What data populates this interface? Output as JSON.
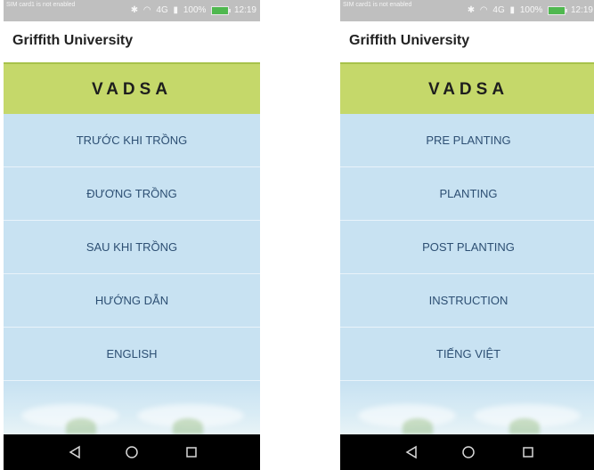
{
  "screens": [
    {
      "status": {
        "sim_text": "SIM card1 is not enabled",
        "battery": "100%",
        "time": "12:19",
        "network": "4G"
      },
      "app_title": "Griffith University",
      "banner": "VADSA",
      "menu": [
        "TRƯỚC KHI TRỒNG",
        "ĐƯƠNG TRỒNG",
        "SAU KHI TRỒNG",
        "HƯỚNG DẪN",
        "ENGLISH"
      ]
    },
    {
      "status": {
        "sim_text": "SIM card1 is not enabled",
        "battery": "100%",
        "time": "12:19",
        "network": "4G"
      },
      "app_title": "Griffith University",
      "banner": "VADSA",
      "menu": [
        "PRE PLANTING",
        "PLANTING",
        "POST PLANTING",
        "INSTRUCTION",
        "TIẾNG VIỆT"
      ]
    }
  ],
  "icons": {
    "back": "triangle-back-icon",
    "home": "circle-home-icon",
    "recents": "square-recents-icon"
  },
  "colors": {
    "banner": "#c5d86a",
    "menu": "#c8e2f2",
    "menu_text": "#2d4f73",
    "navbar": "#000000"
  }
}
